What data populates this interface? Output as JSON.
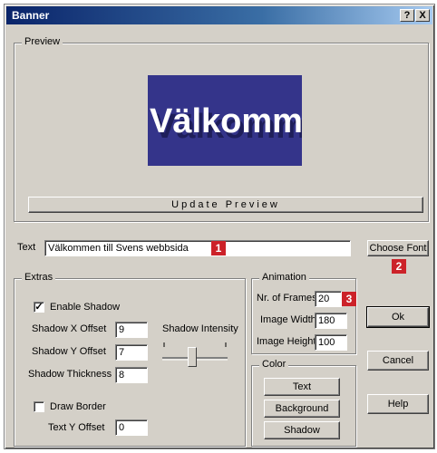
{
  "window": {
    "title": "Banner",
    "help_btn": "?",
    "close_btn": "X"
  },
  "preview": {
    "label": "Preview",
    "banner_text": "Välkommen till Svens webbsida",
    "update_button": "Update Preview"
  },
  "text_row": {
    "label": "Text",
    "value": "Välkommen till Svens webbsida",
    "choose_font": "Choose Font"
  },
  "extras": {
    "label": "Extras",
    "enable_shadow": "Enable Shadow",
    "shadow_x_offset_label": "Shadow X Offset",
    "shadow_x_offset_value": "9",
    "shadow_y_offset_label": "Shadow Y Offset",
    "shadow_y_offset_value": "7",
    "shadow_thickness_label": "Shadow Thickness",
    "shadow_thickness_value": "8",
    "shadow_intensity_label": "Shadow Intensity",
    "draw_border": "Draw Border",
    "text_y_offset_label": "Text Y Offset",
    "text_y_offset_value": "0"
  },
  "animation": {
    "label": "Animation",
    "frames_label": "Nr. of Frames",
    "frames_value": "20",
    "width_label": "Image Width",
    "width_value": "180",
    "height_label": "Image Height",
    "height_value": "100"
  },
  "color": {
    "label": "Color",
    "text_btn": "Text",
    "background_btn": "Background",
    "shadow_btn": "Shadow"
  },
  "buttons": {
    "ok": "Ok",
    "cancel": "Cancel",
    "help": "Help"
  },
  "badges": [
    "1",
    "2",
    "3"
  ],
  "colors": {
    "banner_bg": "#34348a",
    "badge": "#cc2229",
    "dialog": "#d4d0c8"
  }
}
